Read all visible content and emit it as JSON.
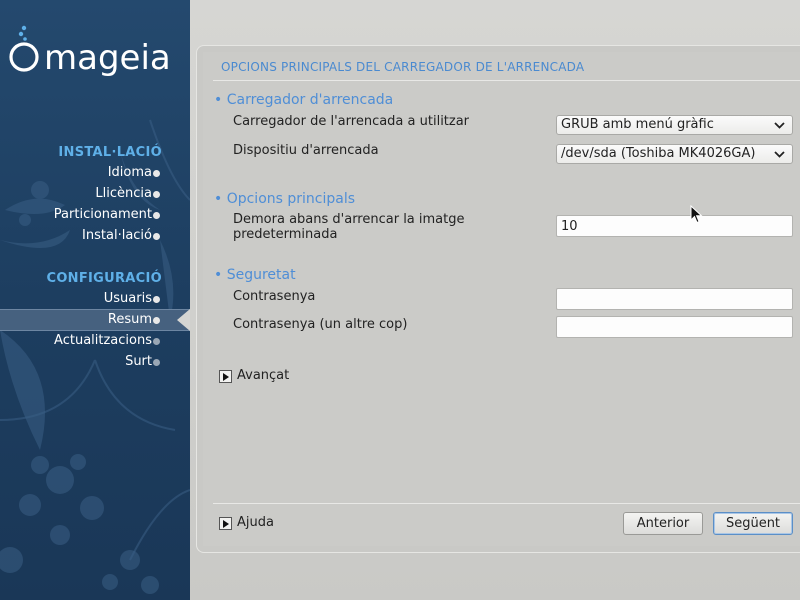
{
  "brand": {
    "name": "mageia"
  },
  "sidebar": {
    "sections": [
      {
        "title": "INSTAL·LACIÓ",
        "items": [
          {
            "label": "Idioma",
            "state": "done"
          },
          {
            "label": "Llicència",
            "state": "done"
          },
          {
            "label": "Particionament",
            "state": "done"
          },
          {
            "label": "Instal·lació",
            "state": "done"
          }
        ]
      },
      {
        "title": "CONFIGURACIÓ",
        "items": [
          {
            "label": "Usuaris",
            "state": "done"
          },
          {
            "label": "Resum",
            "state": "active"
          },
          {
            "label": "Actualitzacions",
            "state": "pending"
          },
          {
            "label": "Surt",
            "state": "pending"
          }
        ]
      }
    ]
  },
  "main": {
    "title": "OPCIONS PRINCIPALS DEL CARREGADOR DE L'ARRENCADA",
    "groups": {
      "bootloader": {
        "heading": "• Carregador d'arrencada",
        "bootloader_label": "Carregador de l'arrencada a utilitzar",
        "bootloader_value": "GRUB amb menú gràfic",
        "device_label": "Dispositiu d'arrencada",
        "device_value": "/dev/sda (Toshiba MK4026GA)"
      },
      "main_options": {
        "heading": "• Opcions principals",
        "delay_label_line1": "Demora abans d'arrencar la imatge",
        "delay_label_line2": "predeterminada",
        "delay_value": "10"
      },
      "security": {
        "heading": "• Seguretat",
        "password_label": "Contrasenya",
        "password_value": "",
        "password_again_label": "Contrasenya (un altre cop)",
        "password_again_value": ""
      }
    },
    "advanced_label": "Avançat",
    "help_label": "Ajuda",
    "buttons": {
      "previous": "Anterior",
      "next": "Següent"
    }
  },
  "colors": {
    "sidebar_bg": "#1d3e60",
    "section_title": "#5fb0e8",
    "heading_blue": "#4f8ed6",
    "panel_bg": "#cbcbc8"
  }
}
